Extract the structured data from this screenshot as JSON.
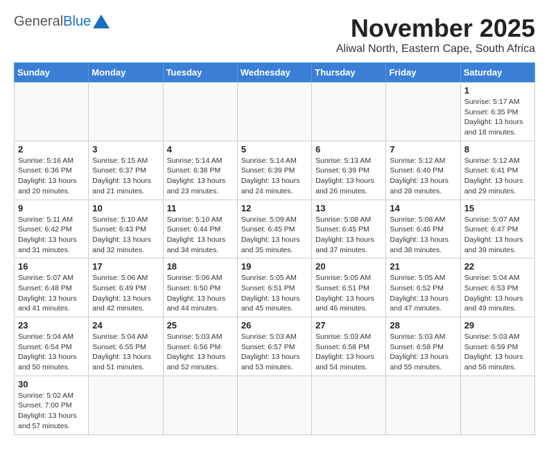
{
  "header": {
    "logo_general": "General",
    "logo_blue": "Blue",
    "month_title": "November 2025",
    "location": "Aliwal North, Eastern Cape, South Africa"
  },
  "days_of_week": [
    "Sunday",
    "Monday",
    "Tuesday",
    "Wednesday",
    "Thursday",
    "Friday",
    "Saturday"
  ],
  "weeks": [
    [
      {
        "day": "",
        "info": ""
      },
      {
        "day": "",
        "info": ""
      },
      {
        "day": "",
        "info": ""
      },
      {
        "day": "",
        "info": ""
      },
      {
        "day": "",
        "info": ""
      },
      {
        "day": "",
        "info": ""
      },
      {
        "day": "1",
        "info": "Sunrise: 5:17 AM\nSunset: 6:35 PM\nDaylight: 13 hours and 18 minutes."
      }
    ],
    [
      {
        "day": "2",
        "info": "Sunrise: 5:16 AM\nSunset: 6:36 PM\nDaylight: 13 hours and 20 minutes."
      },
      {
        "day": "3",
        "info": "Sunrise: 5:15 AM\nSunset: 6:37 PM\nDaylight: 13 hours and 21 minutes."
      },
      {
        "day": "4",
        "info": "Sunrise: 5:14 AM\nSunset: 6:38 PM\nDaylight: 13 hours and 23 minutes."
      },
      {
        "day": "5",
        "info": "Sunrise: 5:14 AM\nSunset: 6:39 PM\nDaylight: 13 hours and 24 minutes."
      },
      {
        "day": "6",
        "info": "Sunrise: 5:13 AM\nSunset: 6:39 PM\nDaylight: 13 hours and 26 minutes."
      },
      {
        "day": "7",
        "info": "Sunrise: 5:12 AM\nSunset: 6:40 PM\nDaylight: 13 hours and 28 minutes."
      },
      {
        "day": "8",
        "info": "Sunrise: 5:12 AM\nSunset: 6:41 PM\nDaylight: 13 hours and 29 minutes."
      }
    ],
    [
      {
        "day": "9",
        "info": "Sunrise: 5:11 AM\nSunset: 6:42 PM\nDaylight: 13 hours and 31 minutes."
      },
      {
        "day": "10",
        "info": "Sunrise: 5:10 AM\nSunset: 6:43 PM\nDaylight: 13 hours and 32 minutes."
      },
      {
        "day": "11",
        "info": "Sunrise: 5:10 AM\nSunset: 6:44 PM\nDaylight: 13 hours and 34 minutes."
      },
      {
        "day": "12",
        "info": "Sunrise: 5:09 AM\nSunset: 6:45 PM\nDaylight: 13 hours and 35 minutes."
      },
      {
        "day": "13",
        "info": "Sunrise: 5:08 AM\nSunset: 6:45 PM\nDaylight: 13 hours and 37 minutes."
      },
      {
        "day": "14",
        "info": "Sunrise: 5:08 AM\nSunset: 6:46 PM\nDaylight: 13 hours and 38 minutes."
      },
      {
        "day": "15",
        "info": "Sunrise: 5:07 AM\nSunset: 6:47 PM\nDaylight: 13 hours and 39 minutes."
      }
    ],
    [
      {
        "day": "16",
        "info": "Sunrise: 5:07 AM\nSunset: 6:48 PM\nDaylight: 13 hours and 41 minutes."
      },
      {
        "day": "17",
        "info": "Sunrise: 5:06 AM\nSunset: 6:49 PM\nDaylight: 13 hours and 42 minutes."
      },
      {
        "day": "18",
        "info": "Sunrise: 5:06 AM\nSunset: 6:50 PM\nDaylight: 13 hours and 44 minutes."
      },
      {
        "day": "19",
        "info": "Sunrise: 5:05 AM\nSunset: 6:51 PM\nDaylight: 13 hours and 45 minutes."
      },
      {
        "day": "20",
        "info": "Sunrise: 5:05 AM\nSunset: 6:51 PM\nDaylight: 13 hours and 46 minutes."
      },
      {
        "day": "21",
        "info": "Sunrise: 5:05 AM\nSunset: 6:52 PM\nDaylight: 13 hours and 47 minutes."
      },
      {
        "day": "22",
        "info": "Sunrise: 5:04 AM\nSunset: 6:53 PM\nDaylight: 13 hours and 49 minutes."
      }
    ],
    [
      {
        "day": "23",
        "info": "Sunrise: 5:04 AM\nSunset: 6:54 PM\nDaylight: 13 hours and 50 minutes."
      },
      {
        "day": "24",
        "info": "Sunrise: 5:04 AM\nSunset: 6:55 PM\nDaylight: 13 hours and 51 minutes."
      },
      {
        "day": "25",
        "info": "Sunrise: 5:03 AM\nSunset: 6:56 PM\nDaylight: 13 hours and 52 minutes."
      },
      {
        "day": "26",
        "info": "Sunrise: 5:03 AM\nSunset: 6:57 PM\nDaylight: 13 hours and 53 minutes."
      },
      {
        "day": "27",
        "info": "Sunrise: 5:03 AM\nSunset: 6:58 PM\nDaylight: 13 hours and 54 minutes."
      },
      {
        "day": "28",
        "info": "Sunrise: 5:03 AM\nSunset: 6:58 PM\nDaylight: 13 hours and 55 minutes."
      },
      {
        "day": "29",
        "info": "Sunrise: 5:03 AM\nSunset: 6:59 PM\nDaylight: 13 hours and 56 minutes."
      }
    ],
    [
      {
        "day": "30",
        "info": "Sunrise: 5:02 AM\nSunset: 7:00 PM\nDaylight: 13 hours and 57 minutes."
      },
      {
        "day": "",
        "info": ""
      },
      {
        "day": "",
        "info": ""
      },
      {
        "day": "",
        "info": ""
      },
      {
        "day": "",
        "info": ""
      },
      {
        "day": "",
        "info": ""
      },
      {
        "day": "",
        "info": ""
      }
    ]
  ]
}
